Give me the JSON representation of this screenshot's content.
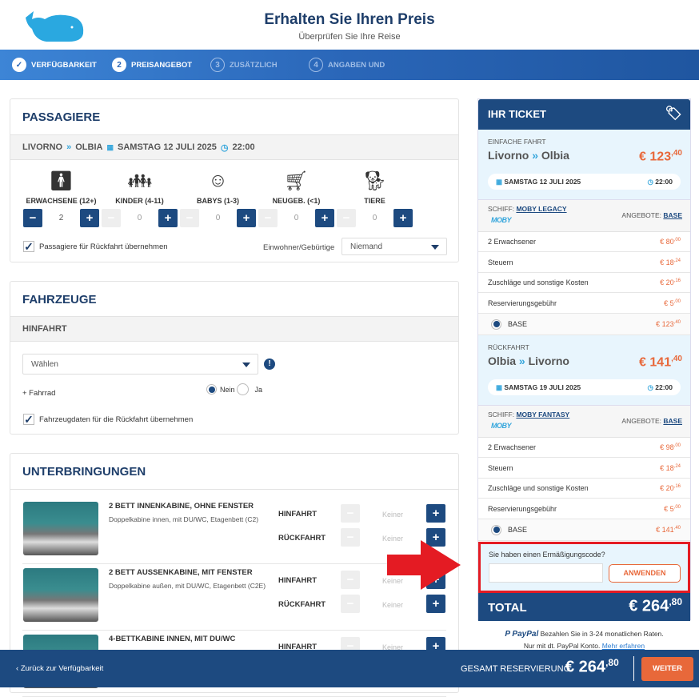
{
  "header": {
    "title": "Erhalten Sie Ihren Preis",
    "subtitle": "Überprüfen Sie Ihre Reise",
    "logo": "whale-logo"
  },
  "steps": [
    {
      "num": "✓",
      "label": "VERFÜGBARKEIT",
      "state": "done"
    },
    {
      "num": "2",
      "label": "PREISANGEBOT",
      "state": "current"
    },
    {
      "num": "3",
      "label": "ZUSÄTZLICH",
      "state": "future"
    },
    {
      "num": "4",
      "label": "ANGABEN UND",
      "state": "future"
    }
  ],
  "passengers": {
    "title": "PASSAGIERE",
    "route_from": "LIVORNO",
    "route_to": "OLBIA",
    "date": "SAMSTAG 12 JULI 2025",
    "time": "22:00",
    "types": [
      {
        "label": "ERWACHSENE (12+)",
        "value": "2",
        "icon": "adult-icon"
      },
      {
        "label": "KINDER (4-11)",
        "value": "0",
        "icon": "child-icon"
      },
      {
        "label": "BABYS (1-3)",
        "value": "0",
        "icon": "baby-icon"
      },
      {
        "label": "NEUGEB. (<1)",
        "value": "0",
        "icon": "stroller-icon"
      },
      {
        "label": "TIERE",
        "value": "0",
        "icon": "dog-icon"
      }
    ],
    "copy_return": "Passagiere für Rückfahrt übernehmen",
    "resident_label": "Einwohner/Gebürtige",
    "resident_value": "Niemand"
  },
  "vehicles": {
    "title": "FAHRZEUGE",
    "subtitle": "HINFAHRT",
    "select_value": "Wählen",
    "bike_label": "+ Fahrrad",
    "no": "Nein",
    "yes": "Ja",
    "copy_return": "Fahrzeugdaten für die Rückfahrt übernehmen"
  },
  "accommodations": {
    "title": "UNTERBRINGUNGEN",
    "out_label": "HINFAHRT",
    "ret_label": "RÜCKFAHRT",
    "none": "Keiner",
    "items": [
      {
        "name": "2 BETT INNENKABINE, OHNE FENSTER",
        "desc": "Doppelkabine innen, mit DU/WC, Etagenbett (C2)"
      },
      {
        "name": "2 BETT AUSSENKABINE, MIT FENSTER",
        "desc": "Doppelkabine außen, mit DU/WC, Etagenbett (C2E)"
      },
      {
        "name": "4-BETTKABINE INNEN, MIT DU/WC",
        "desc": ""
      }
    ]
  },
  "ticket": {
    "title": "IHR TICKET",
    "outbound": {
      "kind": "EINFACHE FAHRT",
      "from": "Livorno",
      "to": "Olbia",
      "price": "€ 123",
      "price_cents": ",40",
      "date": "SAMSTAG 12 JULI 2025",
      "time": "22:00",
      "ship_label": "SCHIFF:",
      "ship": "MOBY LEGACY",
      "brand": "MOBY",
      "offer_label": "ANGEBOTE:",
      "offer": "BASE",
      "lines": [
        {
          "label": "2 Erwachsener",
          "value": "€ 80",
          "cents": ",00"
        },
        {
          "label": "Steuern",
          "value": "€ 18",
          "cents": ",24"
        },
        {
          "label": "Zuschläge und sonstige Kosten",
          "value": "€ 20",
          "cents": ",16"
        },
        {
          "label": "Reservierungsgebühr",
          "value": "€ 5",
          "cents": ",00"
        }
      ],
      "base_label": "BASE",
      "base_value": "€ 123",
      "base_cents": ",40"
    },
    "return": {
      "kind": "RÜCKFAHRT",
      "from": "Olbia",
      "to": "Livorno",
      "price": "€ 141",
      "price_cents": ",40",
      "date": "SAMSTAG 19 JULI 2025",
      "time": "22:00",
      "ship_label": "SCHIFF:",
      "ship": "MOBY FANTASY",
      "brand": "MOBY",
      "offer_label": "ANGEBOTE:",
      "offer": "BASE",
      "lines": [
        {
          "label": "2 Erwachsener",
          "value": "€ 98",
          "cents": ",00"
        },
        {
          "label": "Steuern",
          "value": "€ 18",
          "cents": ",24"
        },
        {
          "label": "Zuschläge und sonstige Kosten",
          "value": "€ 20",
          "cents": ",16"
        },
        {
          "label": "Reservierungsgebühr",
          "value": "€ 5",
          "cents": ",00"
        }
      ],
      "base_label": "BASE",
      "base_value": "€ 141",
      "base_cents": ",40"
    },
    "discount_label": "Sie haben einen Ermäßigungscode?",
    "discount_value": "",
    "apply": "ANWENDEN",
    "total_label": "TOTAL",
    "total": "€ 264",
    "total_cents": ",80",
    "paypal_brand": "PayPal",
    "paypal_text": "Bezahlen Sie in 3-24 monatlichen Raten.",
    "paypal_text2": "Nur mit dt. PayPal Konto.",
    "paypal_link": "Mehr erfahren"
  },
  "footer": {
    "back": "Zurück zur Verfügbarkeit",
    "total_label": "GESAMT RESERVIERUNG",
    "total": "€ 264",
    "total_cents": ",80",
    "next": "WEITER"
  },
  "colors": {
    "primary": "#1d4a80",
    "accent": "#e8683a",
    "highlight": "#e41b23",
    "light": "#e8f5fd"
  }
}
